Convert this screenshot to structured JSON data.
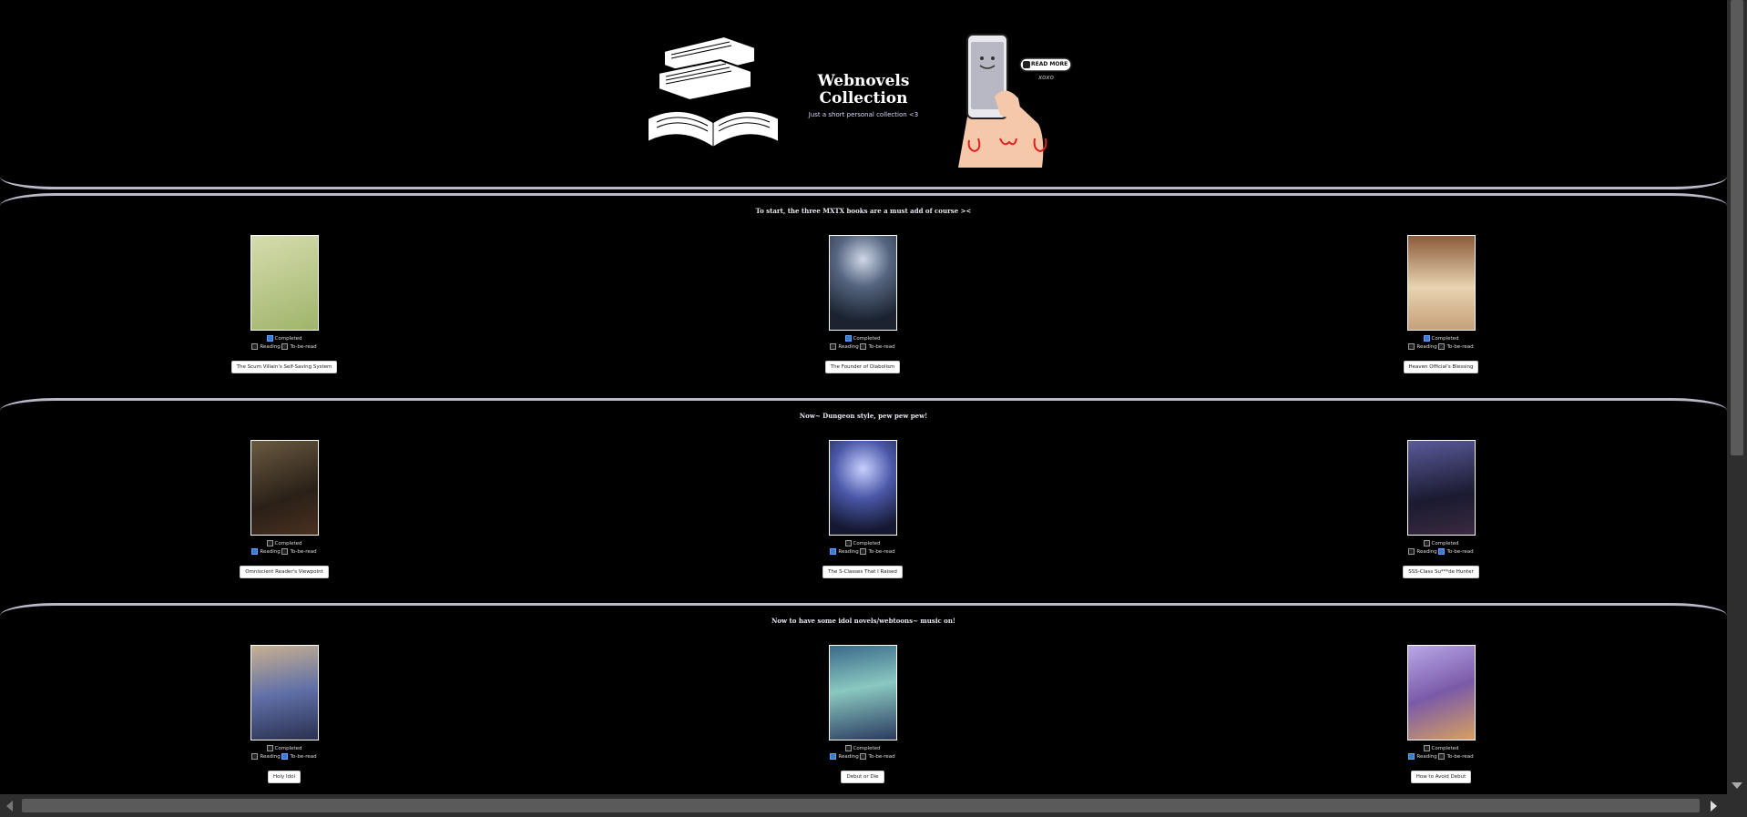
{
  "header": {
    "title_line1": "Webnovels",
    "title_line2": "Collection",
    "subtitle": "Just a short personal collection <3",
    "sign_text": "READ MORE",
    "sign_sub": "xoxo"
  },
  "labels": {
    "completed": "Completed",
    "reading": "Reading",
    "tbr": "To-be-read"
  },
  "sections": [
    {
      "heading": "To start, the three MXTX books are a must add of course ><",
      "books": [
        {
          "title": "The Scum Villain's Self-Saving System",
          "completed": true,
          "reading": false,
          "tbr": false,
          "cover": "#c9d4a0"
        },
        {
          "title": "The Founder of Diabolism",
          "completed": true,
          "reading": false,
          "tbr": false,
          "cover": "#2a3a55"
        },
        {
          "title": "Heaven Official's Blessing",
          "completed": true,
          "reading": false,
          "tbr": false,
          "cover": "#c9a57a"
        }
      ]
    },
    {
      "heading": "Now~ Dungeon style, pew pew pew!",
      "books": [
        {
          "title": "Omniscient Reader's Viewpoint",
          "completed": false,
          "reading": true,
          "tbr": false,
          "cover": "#4a3a28"
        },
        {
          "title": "The S-Classes That I Raised",
          "completed": false,
          "reading": true,
          "tbr": false,
          "cover": "#3a4a88"
        },
        {
          "title": "SSS-Class Su***de Hunter",
          "completed": false,
          "reading": false,
          "tbr": true,
          "cover": "#3a3050"
        }
      ]
    },
    {
      "heading": "Now to have some idol novels/webtoons~ music on!",
      "books": [
        {
          "title": "Holy Idol",
          "completed": false,
          "reading": false,
          "tbr": true,
          "cover": "#6a78a8"
        },
        {
          "title": "Debut or Die",
          "completed": false,
          "reading": true,
          "tbr": false,
          "cover": "#5a8a9a"
        },
        {
          "title": "How to Avoid Debut",
          "completed": false,
          "reading": true,
          "tbr": false,
          "cover": "#8a6aa8"
        }
      ]
    }
  ]
}
